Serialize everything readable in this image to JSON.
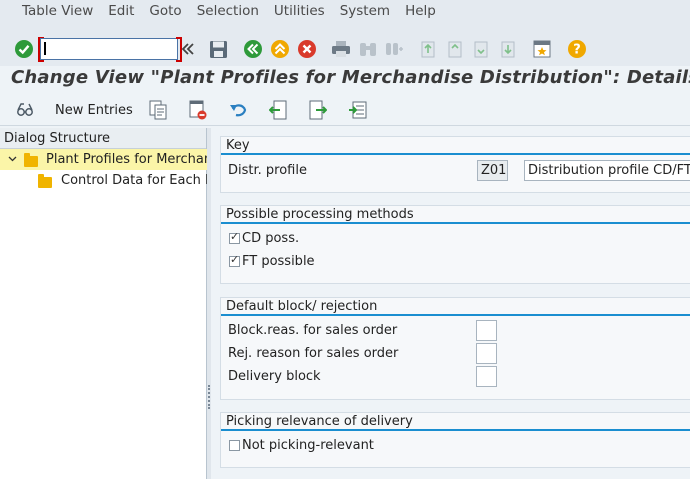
{
  "menu": [
    "Table View",
    "Edit",
    "Goto",
    "Selection",
    "Utilities",
    "System",
    "Help"
  ],
  "command_field": {
    "value": ""
  },
  "title": "Change View \"Plant Profiles for Merchandise Distribution\": Details",
  "app_toolbar": {
    "new_entries": "New Entries"
  },
  "dialog_structure": {
    "header": "Dialog Structure",
    "items": [
      {
        "label": "Plant Profiles for Merchandise Distribution"
      },
      {
        "label": "Control Data for Each B"
      }
    ]
  },
  "key": {
    "title": "Key",
    "distr_profile_label": "Distr. profile",
    "distr_profile_code": "Z01",
    "distr_profile_desc": "Distribution profile CD/FT"
  },
  "processing": {
    "title": "Possible processing methods",
    "cd_poss": "CD poss.",
    "ft_possible": "FT possible"
  },
  "block": {
    "title": "Default block/ rejection",
    "block_reason": "Block.reas. for sales order",
    "rej_reason": "Rej. reason for sales order",
    "delivery_block": "Delivery block"
  },
  "picking": {
    "title": "Picking relevance of delivery",
    "not_picking": "Not picking-relevant"
  },
  "colors": {
    "accent": "#1a8ed0",
    "selected_row": "#fbf5a8",
    "folder": "#f0b400"
  }
}
